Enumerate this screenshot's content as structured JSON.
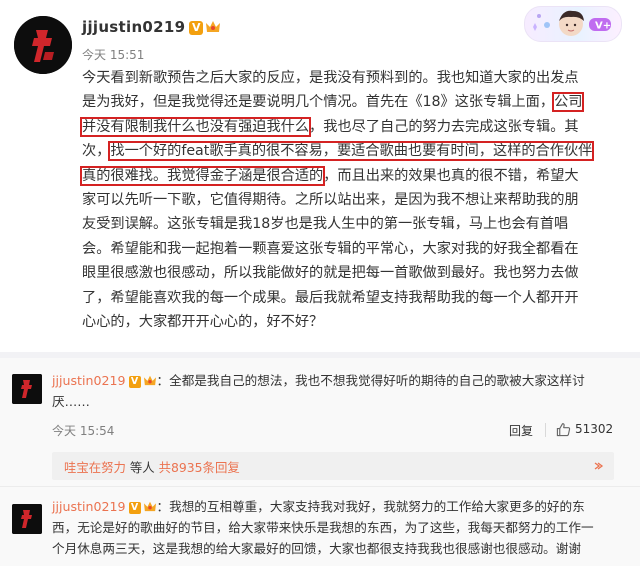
{
  "post": {
    "author": "jjjustin0219",
    "verified_glyph": "V",
    "timestamp": "今天 15:51",
    "lines": [
      "今天看到新歌预告之后大家的反应，是我没有预料到的。我也知道大家的出发点",
      "是为我好，但是我觉得还是要说明几个情况。首先在《18》这张专辑上面，",
      "公司",
      "并没有限制我什么也没有强迫我什么",
      "，我也尽了自己的努力去完成这张专辑。其",
      "次，",
      "找一个好的feat歌手真的很不容易，要适合歌曲也要有时间，这样的合作伙伴",
      "真的很难找。我觉得金子涵是很合适的",
      "，而且出来的效果也真的很不错，希望大",
      "家可以先听一下歌，它值得期待。之所以站出来，是因为我不想让来帮助我的朋",
      "友受到误解。这张专辑是我18岁也是我人生中的第一张专辑，马上也会有首唱",
      "会。希望能和我一起抱着一颗喜爱这张专辑的平常心，大家对我的好我全都看在",
      "眼里很感激也很感动，所以我能做好的就是把每一首歌做到最好。我也努力去做",
      "了，希望能喜欢我的每一个成果。最后我就希望支持我帮助我的每一个人都开开",
      "心心的，大家都开开心心的，好不好？"
    ]
  },
  "comments": [
    {
      "author": "jjjustin0219",
      "text_line1": "：全都是我自己的想法，我也不想我觉得好听的期待的自己的歌被大家这样讨",
      "text_line2": "厌……",
      "timestamp": "今天 15:54",
      "reply_label": "回复",
      "like_count": "51302",
      "replies": {
        "user": "哇宝在努力",
        "middle": " 等人 ",
        "total": "共8935条回复"
      }
    },
    {
      "author": "jjjustin0219",
      "text_line1": "：我想的互相尊重，大家支持我对我好，我就努力的工作给大家更多的好的东",
      "text_line2": "西，无论是好的歌曲好的节目，给大家带来快乐是我想的东西，为了这些，我每天都努力的工作一",
      "text_line3": "个月休息两三天，这是我想的给大家最好的回馈，大家也都很支持我我也很感谢也很感动。谢谢"
    }
  ],
  "colors": {
    "link": "#eb7350",
    "highlight_box": "#d42222",
    "verified": "#f3a00f"
  },
  "icons": [
    "logo-avatar-icon",
    "verified-icon",
    "crown-icon",
    "card-badge-icon",
    "thumbs-up-icon",
    "reply-arrow-icon"
  ]
}
